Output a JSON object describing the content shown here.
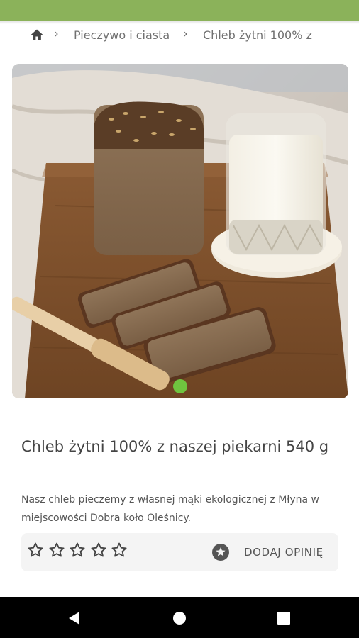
{
  "colors": {
    "status_bar": "#8bb25a",
    "dot_active": "#6fc43f",
    "nav_bar": "#000000"
  },
  "breadcrumb": {
    "home_icon": "home-icon",
    "items": [
      "Pieczywo i ciasta",
      "Chleb żytni 100% z"
    ],
    "separator_icon": "chevron-right-icon"
  },
  "gallery": {
    "image_subject": "photo",
    "page_count": 1,
    "active_page": 1
  },
  "product": {
    "title": "Chleb żytni 100% z naszej piekarni 540 g",
    "description": "Nasz chleb pieczemy z własnej mąki ekologicznej z Młyna w miejscowości Dobra koło Oleśnicy."
  },
  "rating": {
    "stars_filled": 0,
    "stars_total": 5,
    "review_button_label": "DODAJ OPINIĘ",
    "review_icon": "star-circle-icon"
  },
  "nav": {
    "back_icon": "back-triangle-icon",
    "home_icon": "home-circle-icon",
    "recents_icon": "recents-square-icon"
  }
}
